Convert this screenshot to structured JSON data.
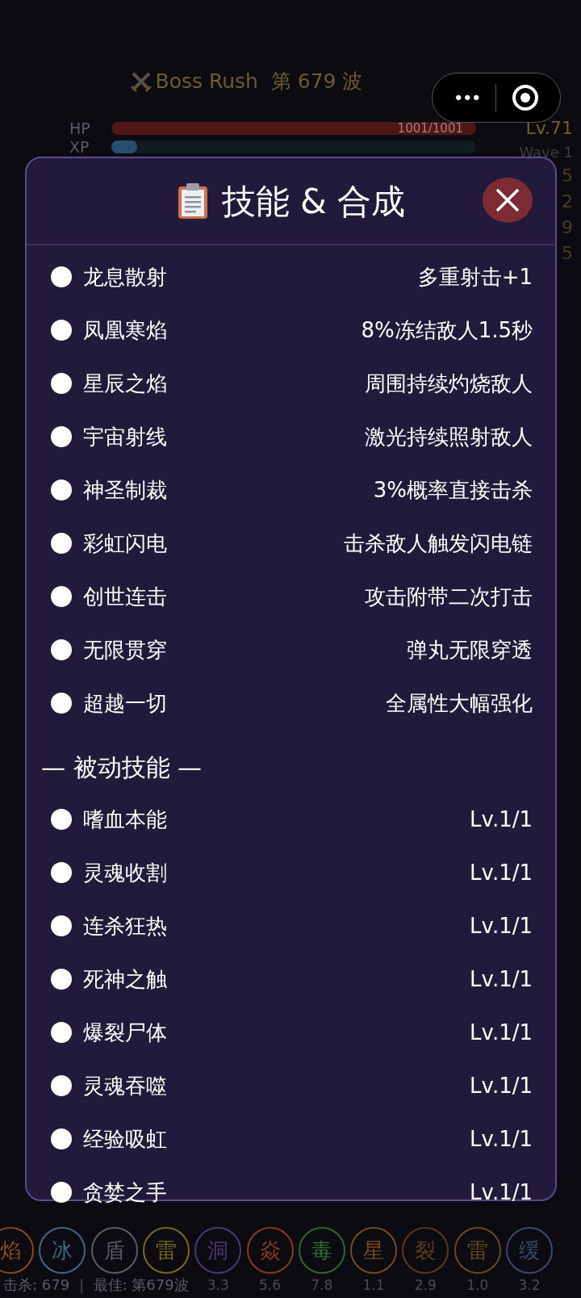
{
  "game": {
    "title": "Boss Rush  第 679 波",
    "hp_label": "HP",
    "hp": {
      "level": 1,
      "reading": "1001/1001"
    },
    "xp_label": "XP",
    "xp": {
      "level": 0.07
    },
    "level": "Lv.71",
    "wave": "Wave 1",
    "side_stats": [
      "5",
      "2",
      "9",
      "5"
    ]
  },
  "capsule": {
    "more": "•••"
  },
  "modal": {
    "title": "技能 & 合成",
    "skills": [
      {
        "name": "龙息散射",
        "effect": "多重射击+1"
      },
      {
        "name": "凤凰寒焰",
        "effect": "8%冻结敌人1.5秒"
      },
      {
        "name": "星辰之焰",
        "effect": "周围持续灼烧敌人"
      },
      {
        "name": "宇宙射线",
        "effect": "激光持续照射敌人"
      },
      {
        "name": "神圣制裁",
        "effect": "3%概率直接击杀"
      },
      {
        "name": "彩虹闪电",
        "effect": "击杀敌人触发闪电链"
      },
      {
        "name": "创世连击",
        "effect": "攻击附带二次打击"
      },
      {
        "name": "无限贯穿",
        "effect": "弹丸无限穿透"
      },
      {
        "name": "超越一切",
        "effect": "全属性大幅强化"
      }
    ],
    "passive_title": "— 被动技能 —",
    "passives": [
      {
        "name": "嗜血本能",
        "level": "Lv.1/1"
      },
      {
        "name": "灵魂收割",
        "level": "Lv.1/1"
      },
      {
        "name": "连杀狂热",
        "level": "Lv.1/1"
      },
      {
        "name": "死神之触",
        "level": "Lv.1/1"
      },
      {
        "name": "爆裂尸体",
        "level": "Lv.1/1"
      },
      {
        "name": "灵魂吞噬",
        "level": "Lv.1/1"
      },
      {
        "name": "经验吸虹",
        "level": "Lv.1/1"
      },
      {
        "name": "贪婪之手",
        "level": "Lv.1/1"
      }
    ]
  },
  "skill_bar": [
    {
      "label": "焰",
      "color": "#8a4a1a"
    },
    {
      "label": "冰",
      "color": "#3a6a8a"
    },
    {
      "label": "盾",
      "color": "#5a5a6a"
    },
    {
      "label": "雷",
      "color": "#7a6a1a"
    },
    {
      "label": "洞",
      "color": "#4a3a78",
      "value": "3.3"
    },
    {
      "label": "焱",
      "color": "#8a3a1a",
      "value": "5.6"
    },
    {
      "label": "毒",
      "color": "#2a6a2a",
      "value": "7.8"
    },
    {
      "label": "星",
      "color": "#7a4a1a",
      "value": "1.1"
    },
    {
      "label": "裂",
      "color": "#5a3a1a",
      "value": "2.9"
    },
    {
      "label": "雷",
      "color": "#6a4a1a",
      "value": "1.0"
    },
    {
      "label": "缓",
      "color": "#3a4a6a",
      "value": "3.2"
    }
  ],
  "status": "击杀: 679 ｜ 最佳: 第679波"
}
